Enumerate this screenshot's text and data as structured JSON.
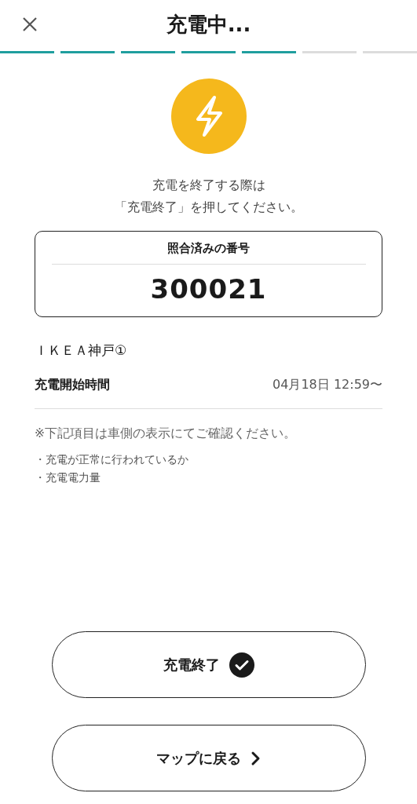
{
  "header": {
    "title": "充電中..."
  },
  "progress_steps": [
    {
      "done": true
    },
    {
      "done": true
    },
    {
      "done": true
    },
    {
      "done": true
    },
    {
      "done": true
    },
    {
      "done": false
    },
    {
      "done": false
    }
  ],
  "message_lines": [
    "充電を終了する際は",
    "「充電終了」を押してください。"
  ],
  "verified_card": {
    "label": "照合済みの番号",
    "number": "300021"
  },
  "station_name": "ＩＫＥＡ神戸①",
  "start_time": {
    "label": "充電開始時間",
    "value": "04月18日 12:59〜"
  },
  "notice": "※下記項目は車側の表示にてご確認ください。",
  "check_items": [
    "・充電が正常に行われているか",
    "・充電電力量"
  ],
  "buttons": [
    {
      "label": "充電終了",
      "kind": "finish"
    },
    {
      "label": "マップに戻る",
      "kind": "back"
    }
  ]
}
